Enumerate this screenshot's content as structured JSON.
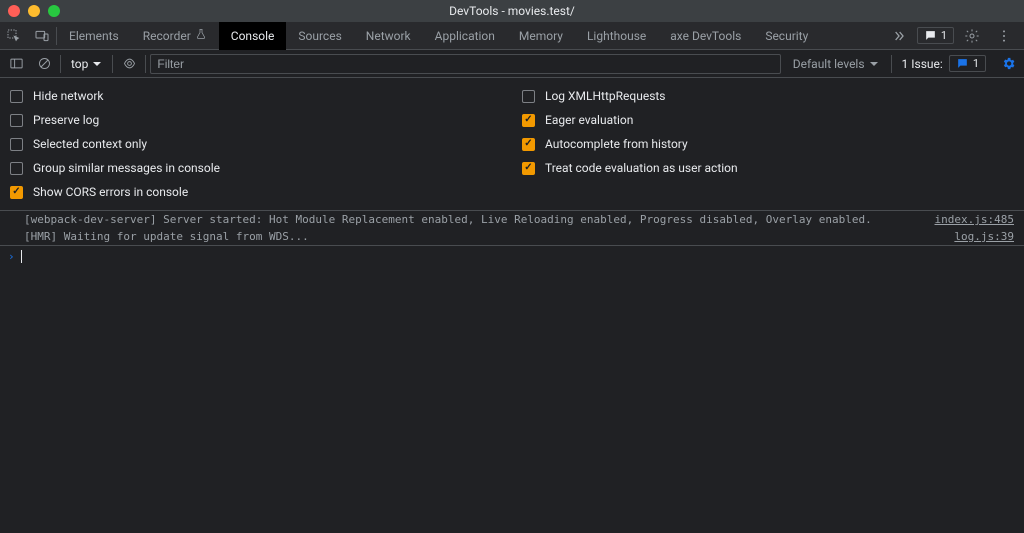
{
  "window": {
    "title": "DevTools - movies.test/"
  },
  "tabs": [
    {
      "label": "Elements"
    },
    {
      "label": "Recorder"
    },
    {
      "label": "Console"
    },
    {
      "label": "Sources"
    },
    {
      "label": "Network"
    },
    {
      "label": "Application"
    },
    {
      "label": "Memory"
    },
    {
      "label": "Lighthouse"
    },
    {
      "label": "axe DevTools"
    },
    {
      "label": "Security"
    }
  ],
  "toolbar": {
    "message_badge_count": "1"
  },
  "console_toolbar": {
    "context": "top",
    "filter_placeholder": "Filter",
    "levels_label": "Default levels",
    "issues_label": "1 Issue:",
    "issues_count": "1"
  },
  "settings": {
    "left": [
      {
        "label": "Hide network",
        "checked": false
      },
      {
        "label": "Preserve log",
        "checked": false
      },
      {
        "label": "Selected context only",
        "checked": false
      },
      {
        "label": "Group similar messages in console",
        "checked": false
      },
      {
        "label": "Show CORS errors in console",
        "checked": true
      }
    ],
    "right": [
      {
        "label": "Log XMLHttpRequests",
        "checked": false
      },
      {
        "label": "Eager evaluation",
        "checked": true
      },
      {
        "label": "Autocomplete from history",
        "checked": true
      },
      {
        "label": "Treat code evaluation as user action",
        "checked": true
      }
    ]
  },
  "logs": [
    {
      "msg": "[webpack-dev-server] Server started: Hot Module Replacement enabled, Live Reloading enabled, Progress disabled, Overlay enabled.",
      "src": "index.js:485"
    },
    {
      "msg": "[HMR] Waiting for update signal from WDS...",
      "src": "log.js:39"
    }
  ]
}
